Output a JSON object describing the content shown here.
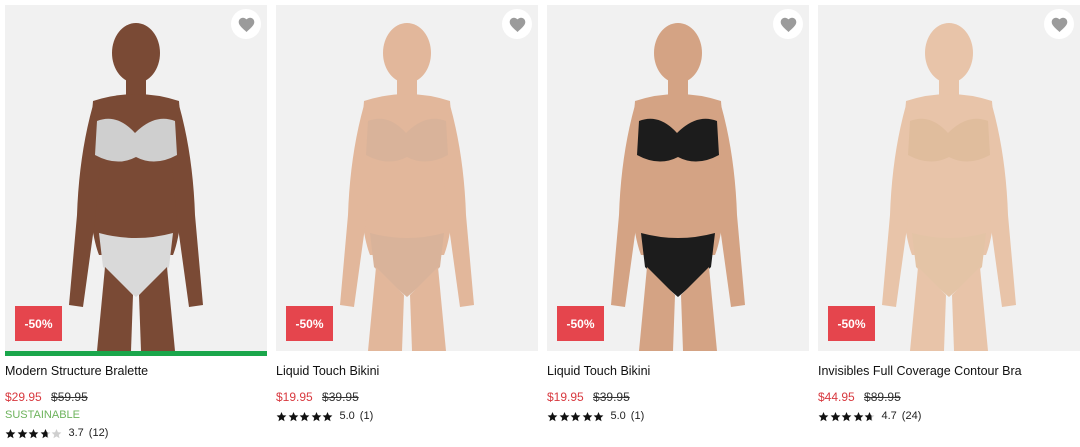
{
  "products": [
    {
      "name": "Modern Structure Bralette",
      "discount": "-50%",
      "price": "$29.95",
      "original_price": "$59.95",
      "tag": "SUSTAINABLE",
      "rating": "3.7",
      "reviews": "(12)",
      "stars_filled": 3.7,
      "skin": "#7a4a35",
      "top": "#cfcfcf",
      "bottom": "#d9d9d9",
      "highlight_bar": "#1aa64b"
    },
    {
      "name": "Liquid Touch Bikini",
      "discount": "-50%",
      "price": "$19.95",
      "original_price": "$39.95",
      "rating": "5.0",
      "reviews": "(1)",
      "stars_filled": 5,
      "skin": "#e2b79b",
      "top": "#d9b39a",
      "bottom": "#d9b39a"
    },
    {
      "name": "Liquid Touch Bikini",
      "discount": "-50%",
      "price": "$19.95",
      "original_price": "$39.95",
      "rating": "5.0",
      "reviews": "(1)",
      "stars_filled": 5,
      "skin": "#d4a384",
      "top": "#1c1c1c",
      "bottom": "#1c1c1c"
    },
    {
      "name": "Invisibles Full Coverage Contour Bra",
      "discount": "-50%",
      "price": "$44.95",
      "original_price": "$89.95",
      "rating": "4.7",
      "reviews": "(24)",
      "stars_filled": 4.7,
      "skin": "#e8c4a9",
      "top": "#e0bd9d",
      "bottom": "#e4c4a6"
    }
  ],
  "colors": {
    "sale": "#d8393f",
    "badge": "#e5454d",
    "sustainable": "#6db35c",
    "image_bg": "#f1f1f1"
  }
}
